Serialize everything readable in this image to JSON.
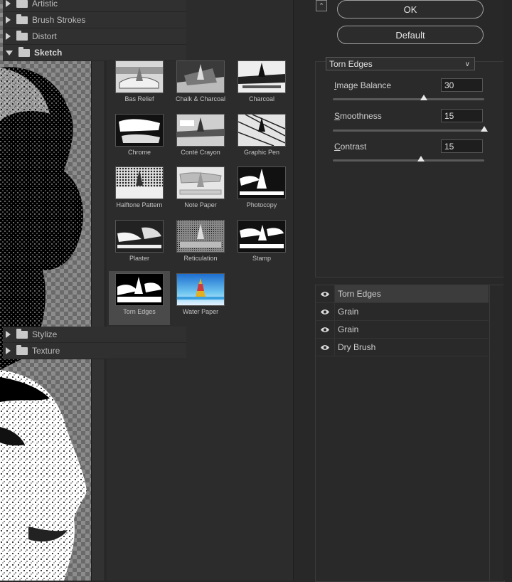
{
  "gallery": {
    "folders_top": [
      {
        "label": "Artistic"
      },
      {
        "label": "Brush Strokes"
      },
      {
        "label": "Distort"
      },
      {
        "label": "Sketch"
      }
    ],
    "thumbnails": [
      {
        "label": "Bas Relief"
      },
      {
        "label": "Chalk & Charcoal"
      },
      {
        "label": "Charcoal"
      },
      {
        "label": "Chrome"
      },
      {
        "label": "Conté Crayon"
      },
      {
        "label": "Graphic Pen"
      },
      {
        "label": "Halftone Pattern"
      },
      {
        "label": "Note Paper"
      },
      {
        "label": "Photocopy"
      },
      {
        "label": "Plaster"
      },
      {
        "label": "Reticulation"
      },
      {
        "label": "Stamp"
      },
      {
        "label": "Torn Edges"
      },
      {
        "label": "Water Paper"
      }
    ],
    "selected_thumbnail": "Torn Edges",
    "folders_bottom": [
      {
        "label": "Stylize"
      },
      {
        "label": "Texture"
      }
    ]
  },
  "dialog": {
    "ok_label": "OK",
    "default_label": "Default"
  },
  "filter_settings": {
    "selected_filter": "Torn Edges",
    "params": [
      {
        "label_first": "I",
        "label_rest": "mage Balance",
        "value": "30",
        "slider_fraction": 0.6
      },
      {
        "label_first": "S",
        "label_rest": "moothness",
        "value": "15",
        "slider_fraction": 1.0
      },
      {
        "label_first": "C",
        "label_rest": "ontrast",
        "value": "15",
        "slider_fraction": 0.58
      }
    ]
  },
  "effect_layers": [
    {
      "label": "Torn Edges",
      "visible_icon": "eye-icon",
      "selected": true
    },
    {
      "label": "Grain",
      "visible_icon": "eye-icon",
      "selected": false
    },
    {
      "label": "Grain",
      "visible_icon": "eye-icon",
      "selected": false
    },
    {
      "label": "Dry Brush",
      "visible_icon": "eye-icon",
      "selected": false
    }
  ],
  "colors": {
    "panel_bg": "#282828",
    "selected_row": "#3c3c3c",
    "accent_text": "#e6e6e6"
  }
}
